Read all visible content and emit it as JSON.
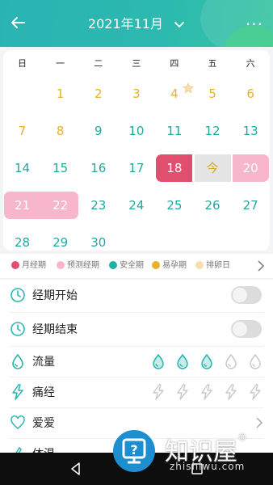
{
  "header": {
    "title": "2021年11月",
    "more": "···"
  },
  "weekdays": [
    "日",
    "一",
    "二",
    "三",
    "四",
    "五",
    "六"
  ],
  "days": [
    {
      "t": "1",
      "c": "yellow",
      "r": 0,
      "col": 1
    },
    {
      "t": "2",
      "c": "yellow",
      "r": 0,
      "col": 2
    },
    {
      "t": "3",
      "c": "yellow",
      "r": 0,
      "col": 3
    },
    {
      "t": "4",
      "c": "yellow",
      "r": 0,
      "col": 4
    },
    {
      "t": "5",
      "c": "yellow",
      "r": 0,
      "col": 5
    },
    {
      "t": "6",
      "c": "yellow",
      "r": 0,
      "col": 6
    },
    {
      "t": "7",
      "c": "yellow",
      "r": 1,
      "col": 0
    },
    {
      "t": "8",
      "c": "yellow",
      "r": 1,
      "col": 1
    },
    {
      "t": "9",
      "c": "green",
      "r": 1,
      "col": 2
    },
    {
      "t": "10",
      "c": "green",
      "r": 1,
      "col": 3
    },
    {
      "t": "11",
      "c": "green",
      "r": 1,
      "col": 4
    },
    {
      "t": "12",
      "c": "green",
      "r": 1,
      "col": 5
    },
    {
      "t": "13",
      "c": "green",
      "r": 1,
      "col": 6
    },
    {
      "t": "14",
      "c": "green",
      "r": 2,
      "col": 0
    },
    {
      "t": "15",
      "c": "green",
      "r": 2,
      "col": 1
    },
    {
      "t": "16",
      "c": "green",
      "r": 2,
      "col": 2
    },
    {
      "t": "17",
      "c": "green",
      "r": 2,
      "col": 3
    },
    {
      "t": "18",
      "c": "red",
      "r": 2,
      "col": 4
    },
    {
      "t": "今",
      "c": "today",
      "r": 2,
      "col": 5
    },
    {
      "t": "20",
      "c": "pink",
      "r": 2,
      "col": 6
    },
    {
      "t": "21",
      "c": "pink",
      "r": 3,
      "col": 0
    },
    {
      "t": "22",
      "c": "pink",
      "r": 3,
      "col": 1
    },
    {
      "t": "23",
      "c": "green",
      "r": 3,
      "col": 2
    },
    {
      "t": "24",
      "c": "green",
      "r": 3,
      "col": 3
    },
    {
      "t": "25",
      "c": "green",
      "r": 3,
      "col": 4
    },
    {
      "t": "26",
      "c": "green",
      "r": 3,
      "col": 5
    },
    {
      "t": "27",
      "c": "green",
      "r": 3,
      "col": 6
    },
    {
      "t": "28",
      "c": "green",
      "r": 4,
      "col": 0
    },
    {
      "t": "29",
      "c": "green",
      "r": 4,
      "col": 1
    },
    {
      "t": "30",
      "c": "green",
      "r": 4,
      "col": 2
    }
  ],
  "legend": [
    {
      "label": "月经期",
      "color": "#e0506e"
    },
    {
      "label": "预测经期",
      "color": "#f7b6cc"
    },
    {
      "label": "安全期",
      "color": "#23b0a4"
    },
    {
      "label": "易孕期",
      "color": "#e6b12b"
    },
    {
      "label": "排卵日",
      "color": "#f7dfb0"
    }
  ],
  "rows": {
    "period_start": "经期开始",
    "period_end": "经期结束",
    "flow": "流量",
    "pain": "痛经",
    "love": "爱爱",
    "temp": "体温"
  },
  "watermark": {
    "brand": "知识屋",
    "reg": "®",
    "sub": "zhishiwu.com"
  },
  "colors": {
    "accent": "#2cb5b1",
    "period": "#e0506e",
    "predicted": "#f7b6cc",
    "today": "#e5e5e5"
  }
}
